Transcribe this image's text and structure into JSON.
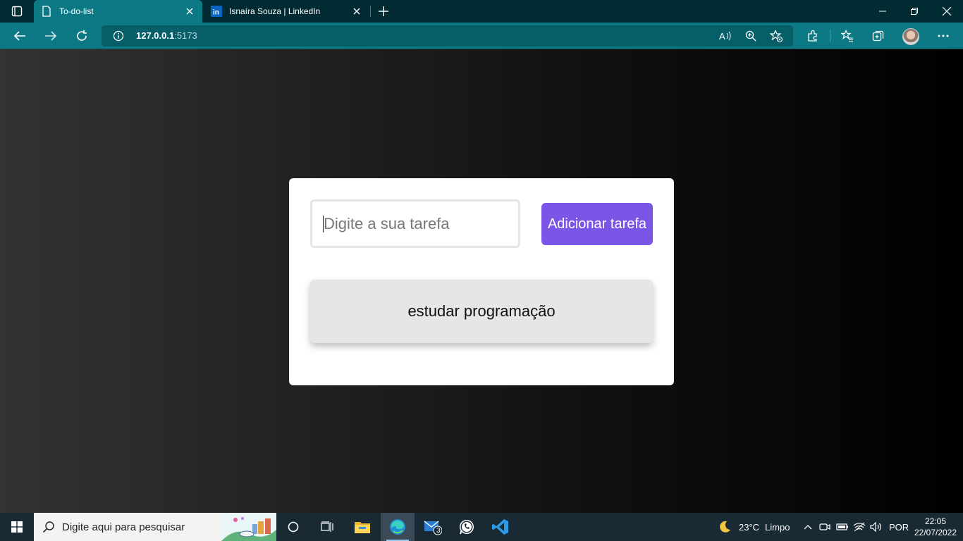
{
  "browser": {
    "tabs": [
      {
        "title": "To-do-list",
        "favicon": "document-icon",
        "active": true
      },
      {
        "title": "Isnaíra Souza | LinkedIn",
        "favicon": "linkedin-icon",
        "active": false
      }
    ],
    "address": {
      "host": "127.0.0.1",
      "port": ":5173"
    }
  },
  "app": {
    "input_placeholder": "Digite a sua tarefa",
    "add_button_label": "Adicionar tarefa",
    "tasks": [
      "estudar programação"
    ],
    "colors": {
      "accent": "#7b55e6",
      "task_bg": "#e6e6e6",
      "card_bg": "#ffffff"
    }
  },
  "taskbar": {
    "search_placeholder": "Digite aqui para pesquisar",
    "mail_badge": "3",
    "weather": {
      "temp": "23°C",
      "condition": "Limpo"
    },
    "language": "POR",
    "time": "22:05",
    "date": "22/07/2022"
  }
}
